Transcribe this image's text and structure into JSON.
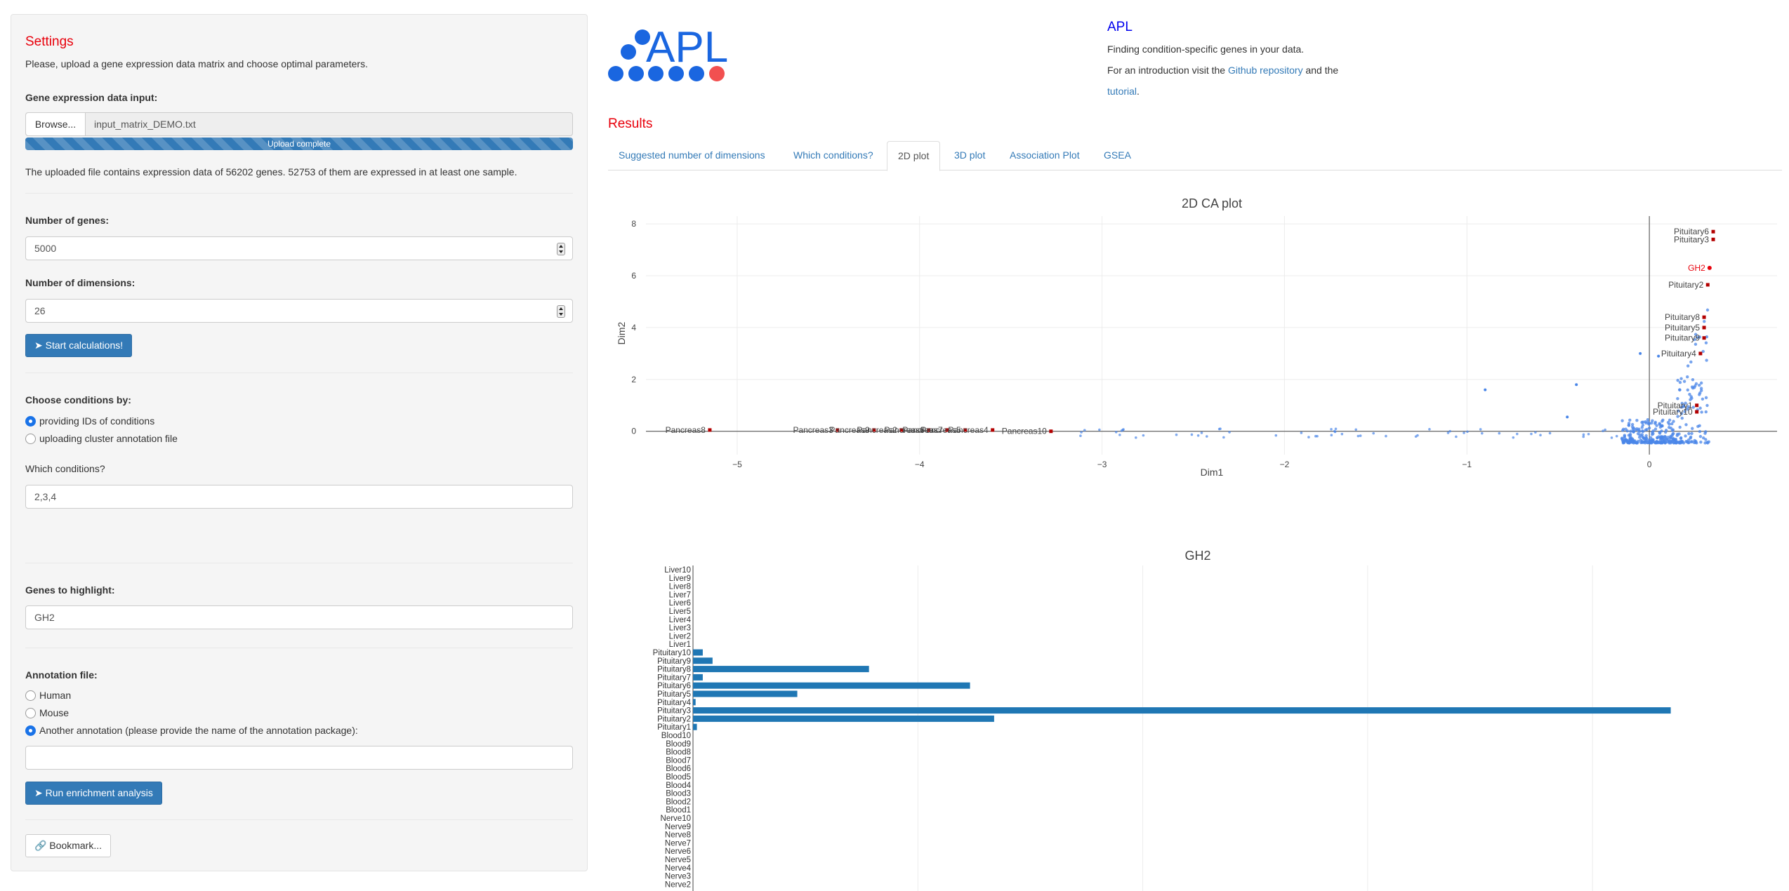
{
  "sidebar": {
    "title": "Settings",
    "intro": "Please, upload a gene expression data matrix and choose optimal parameters.",
    "upload": {
      "label": "Gene expression data input:",
      "browse_label": "Browse...",
      "file_name": "input_matrix_DEMO.txt",
      "progress_label": "Upload complete",
      "progress": 1.0,
      "info": "The uploaded file contains expression data of 56202 genes. 52753 of them are expressed in at least one sample."
    },
    "num_genes": {
      "label": "Number of genes:",
      "value": "5000"
    },
    "num_dims": {
      "label": "Number of dimensions:",
      "value": "26"
    },
    "start_button": "Start calculations!",
    "conditions": {
      "label": "Choose conditions by:",
      "options": [
        "providing IDs of conditions",
        "uploading cluster annotation file"
      ],
      "selected": 0,
      "which_label": "Which conditions?",
      "which_value": "2,3,4"
    },
    "highlight": {
      "label": "Genes to highlight:",
      "value": "GH2"
    },
    "annotation": {
      "label": "Annotation file:",
      "options": [
        "Human",
        "Mouse",
        "Another annotation (please provide the name of the annotation package):"
      ],
      "selected": 2,
      "value": ""
    },
    "enrich_button": "Run enrichment analysis",
    "bookmark_button": "Bookmark..."
  },
  "header": {
    "logo_text": "APL",
    "app_title": "APL",
    "subtitle": "Finding condition-specific genes in your data.",
    "intro_prefix": "For an introduction visit the ",
    "github_link": "Github repository",
    "intro_middle": " and the",
    "tutorial_link": "tutorial",
    "intro_suffix": "."
  },
  "results": {
    "title": "Results",
    "tabs": [
      "Suggested number of dimensions",
      "Which conditions?",
      "2D plot",
      "3D plot",
      "Association Plot",
      "GSEA"
    ],
    "active_tab": 2
  },
  "colors": {
    "accent_red": "#e8000b",
    "link_blue": "#337ab7",
    "logo_blue": "#1a66e0",
    "logo_red": "#f25050",
    "point_blue": "#4a86e8",
    "bar_blue": "#1f77b4",
    "marker_red": "#b30000"
  },
  "chart_data": [
    {
      "type": "scatter",
      "title": "2D CA plot",
      "xlabel": "Dim1",
      "ylabel": "Dim2",
      "xlim": [
        -5.5,
        0.7
      ],
      "ylim": [
        -0.9,
        8.3
      ],
      "x_ticks": [
        -5,
        -4,
        -3,
        -2,
        -1,
        0
      ],
      "y_ticks": [
        0,
        2,
        4,
        6,
        8
      ],
      "grid": true,
      "highlighted_gene": {
        "name": "GH2",
        "x": 0.33,
        "y": 6.3
      },
      "sample_points": [
        {
          "name": "Pancreas8",
          "x": -5.15,
          "y": 0.05
        },
        {
          "name": "Pancreas3",
          "x": -4.45,
          "y": 0.05
        },
        {
          "name": "Pancreas9",
          "x": -4.25,
          "y": 0.05
        },
        {
          "name": "Pancreas2",
          "x": -4.1,
          "y": 0.05
        },
        {
          "name": "Pancreas6",
          "x": -3.95,
          "y": 0.05
        },
        {
          "name": "Pancreas7",
          "x": -3.85,
          "y": 0.05
        },
        {
          "name": "Pancreas5",
          "x": -3.75,
          "y": 0.05
        },
        {
          "name": "Pancreas4",
          "x": -3.6,
          "y": 0.05
        },
        {
          "name": "Pancreas10",
          "x": -3.28,
          "y": 0.0
        },
        {
          "name": "Pituitary6",
          "x": 0.35,
          "y": 7.7
        },
        {
          "name": "Pituitary3",
          "x": 0.35,
          "y": 7.4
        },
        {
          "name": "Pituitary2",
          "x": 0.32,
          "y": 5.65
        },
        {
          "name": "Pituitary8",
          "x": 0.3,
          "y": 4.4
        },
        {
          "name": "Pituitary5",
          "x": 0.3,
          "y": 4.0
        },
        {
          "name": "Pituitary9",
          "x": 0.3,
          "y": 3.6
        },
        {
          "name": "Pituitary4",
          "x": 0.28,
          "y": 3.0
        },
        {
          "name": "Pituitary1",
          "x": 0.26,
          "y": 1.0
        },
        {
          "name": "Pituitary10",
          "x": 0.26,
          "y": 0.75
        }
      ]
    },
    {
      "type": "bar",
      "orientation": "horizontal",
      "title": "GH2",
      "categories": [
        "Liver10",
        "Liver9",
        "Liver8",
        "Liver7",
        "Liver6",
        "Liver5",
        "Liver4",
        "Liver3",
        "Liver2",
        "Liver1",
        "Pituitary10",
        "Pituitary9",
        "Pituitary8",
        "Pituitary7",
        "Pituitary6",
        "Pituitary5",
        "Pituitary4",
        "Pituitary3",
        "Pituitary2",
        "Pituitary1",
        "Blood10",
        "Blood9",
        "Blood8",
        "Blood7",
        "Blood6",
        "Blood5",
        "Blood4",
        "Blood3",
        "Blood2",
        "Blood1",
        "Nerve10",
        "Nerve9",
        "Nerve8",
        "Nerve7",
        "Nerve6",
        "Nerve5",
        "Nerve4",
        "Nerve3",
        "Nerve2"
      ],
      "values": [
        0,
        0,
        0,
        0,
        0,
        0,
        0,
        0,
        0,
        0,
        15,
        30,
        270,
        15,
        425,
        160,
        4,
        1500,
        462,
        6,
        0,
        0,
        0,
        0,
        0,
        0,
        0,
        0,
        0,
        0,
        0,
        0,
        0,
        0,
        0,
        0,
        0,
        0,
        0
      ],
      "xlim": [
        0,
        1550
      ],
      "x_gridlines": [
        0,
        345,
        690,
        1035,
        1380
      ],
      "grid": true
    }
  ]
}
